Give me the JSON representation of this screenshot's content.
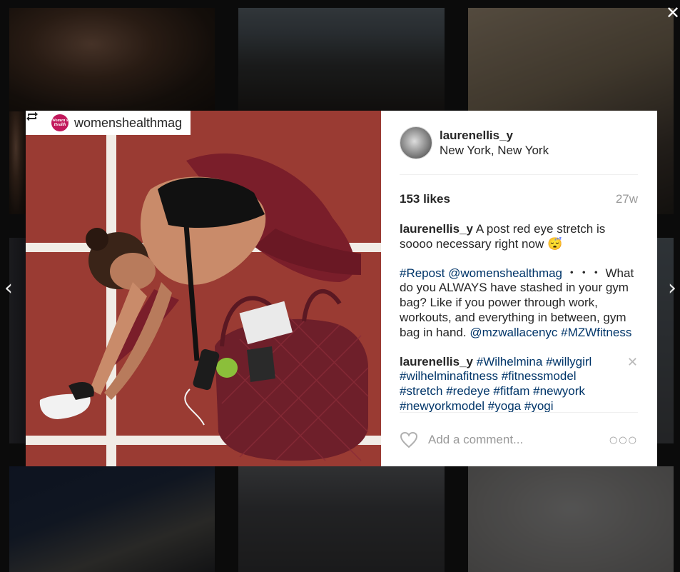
{
  "post": {
    "repost_user": "womenshealthmag",
    "repost_avatar_text": "Women's Health",
    "author": "laurenellis_y",
    "location": "New York, New York",
    "likes": "153 likes",
    "time_ago": "27w",
    "caption_user": "laurenellis_y",
    "caption_text": "A post red eye stretch is soooo necessary right now",
    "caption_emoji": "😴",
    "repost_tag": "#Repost",
    "repost_mention": "@womenshealthmag",
    "repost_dots": "・・・",
    "repost_body": "What do you ALWAYS have stashed in your gym bag? Like if you power through work, workouts, and everything in between, gym bag in hand.",
    "repost_brand": "@mzwallacenyc",
    "repost_brand_tag": "#MZWfitness",
    "comment_user": "laurenellis_y",
    "comment_tags": [
      "#Wilhelmina",
      "#willygirl",
      "#wilhelminafitness",
      "#fitnessmodel",
      "#stretch",
      "#redeye",
      "#fitfam",
      "#newyork",
      "#newyorkmodel",
      "#yoga",
      "#yogi"
    ],
    "comment_placeholder": "Add a comment...",
    "more_label": "○○○",
    "close_glyph": "✕",
    "delete_glyph": "✕",
    "prev_glyph": "‹",
    "next_glyph": "›"
  },
  "icons": {
    "close": "close-icon",
    "prev": "chevron-left-icon",
    "next": "chevron-right-icon",
    "repost": "repost-icon",
    "heart": "heart-icon",
    "more": "more-options-icon"
  },
  "colors": {
    "link": "#003569",
    "court": "#9a3b33",
    "bag": "#6e1f2a"
  }
}
